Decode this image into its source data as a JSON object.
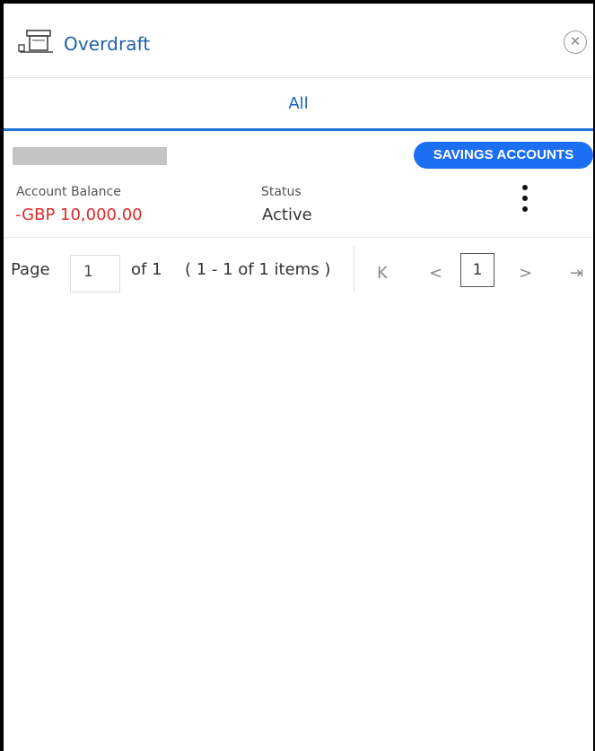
{
  "header": {
    "title": "Overdraft",
    "icon": "overdraft-icon",
    "close_icon": "close-icon"
  },
  "tabs": [
    {
      "label": "All",
      "active": true
    }
  ],
  "card": {
    "badge": "SAVINGS ACCOUNTS",
    "balance_label": "Account Balance",
    "balance_value": "-GBP 10,000.00",
    "status_label": "Status",
    "status_value": "Active",
    "menu_icon": "more-vertical-icon"
  },
  "pager": {
    "page_label": "Page",
    "page_value": "1",
    "of_label": "of 1",
    "items_label": "( 1 - 1 of 1 items )",
    "first_glyph": "K",
    "prev_glyph": "<",
    "current_page": "1",
    "next_glyph": ">",
    "last_glyph": "⇥"
  },
  "colors": {
    "accent": "#1d6ff2",
    "title": "#1f5fa8",
    "negative": "#e02b2b"
  }
}
